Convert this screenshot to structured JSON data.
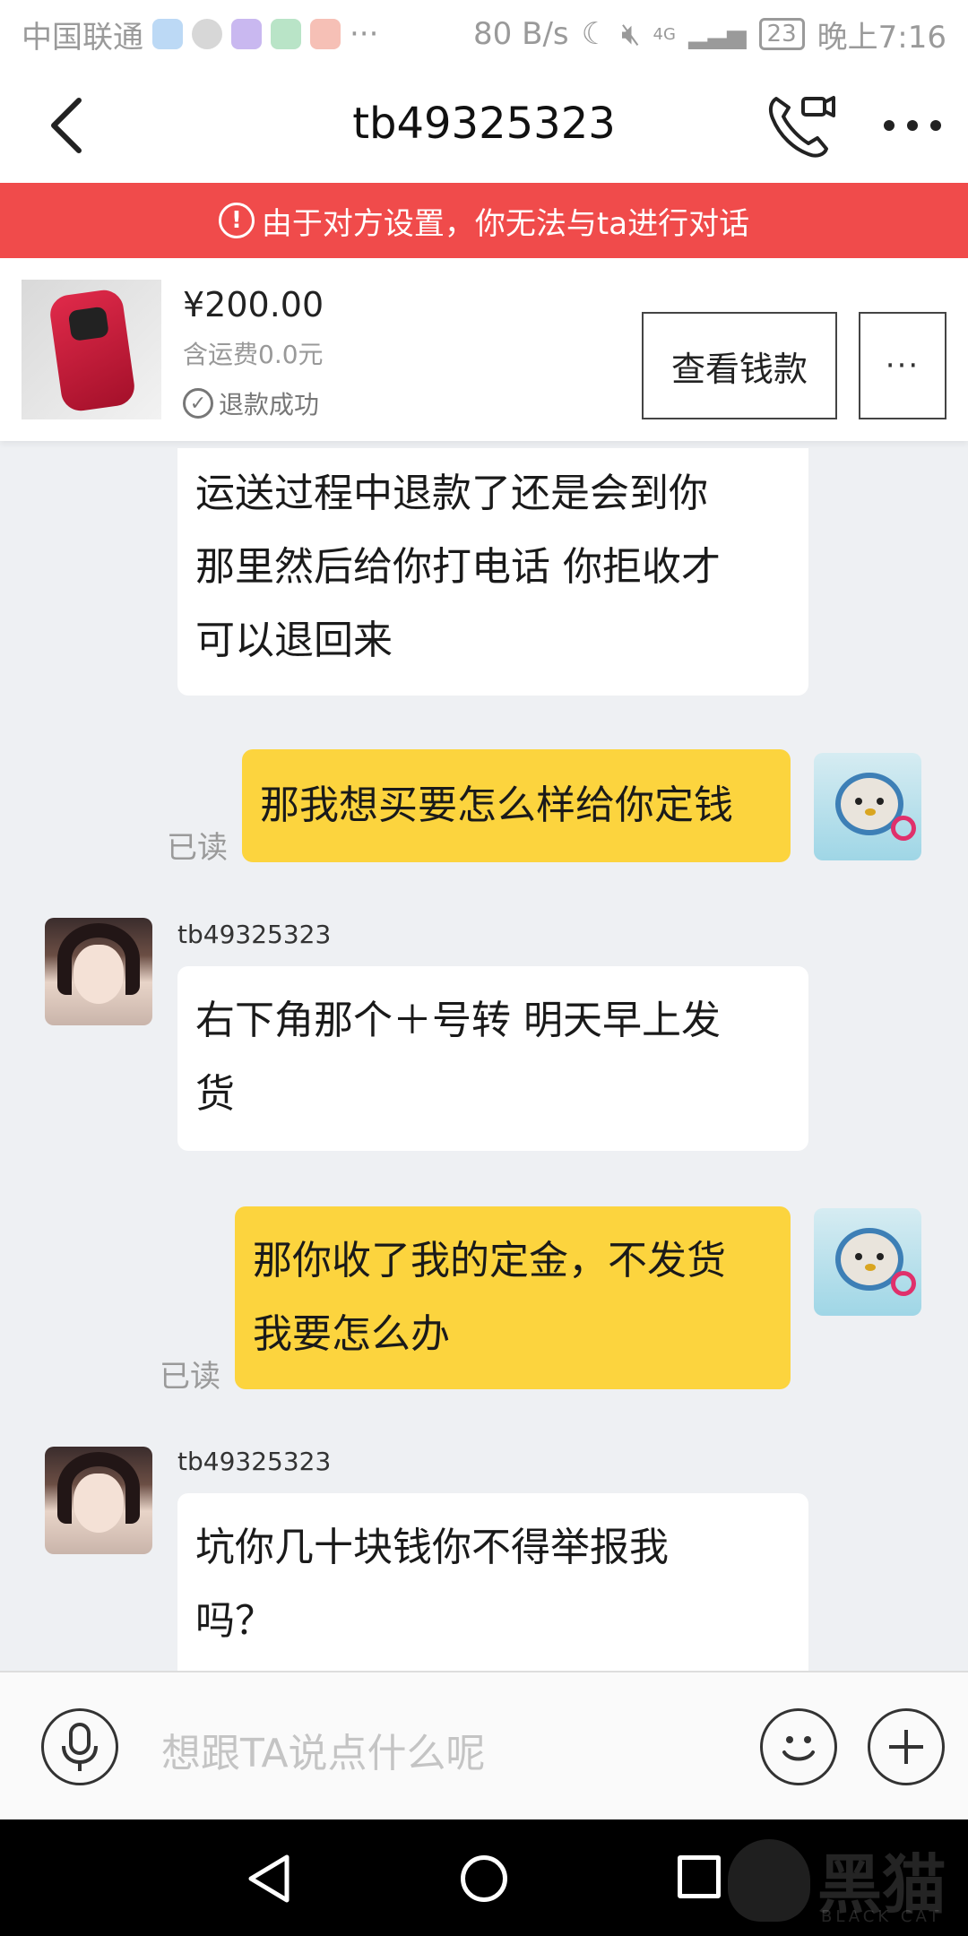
{
  "status_bar": {
    "carrier": "中国联通",
    "extra": "···",
    "speed": "80 B/s",
    "network": "4G",
    "battery": "23",
    "time": "晚上7:16"
  },
  "header": {
    "title": "tb49325323"
  },
  "banner": {
    "text": "由于对方设置，你无法与ta进行对话"
  },
  "product": {
    "price": "¥200.00",
    "shipping": "含运费0.0元",
    "status": "退款成功",
    "view_button": "查看钱款",
    "more_button": "···"
  },
  "messages": [
    {
      "side": "in",
      "text_lines": [
        "运送过程中退款了还是会到你",
        "那里然后给你打电话 你拒收才",
        "可以退回来"
      ]
    },
    {
      "side": "out",
      "read": "已读",
      "text_lines": [
        "那我想买要怎么样给你定钱"
      ]
    },
    {
      "side": "in",
      "sender": "tb49325323",
      "text_lines": [
        "右下角那个＋号转 明天早上发",
        "货"
      ]
    },
    {
      "side": "out",
      "read": "已读",
      "text_lines": [
        "那你收了我的定金，不发货",
        "我要怎么办"
      ]
    },
    {
      "side": "in",
      "sender": "tb49325323",
      "text_lines": [
        "坑你几十块钱你不得举报我",
        "吗？"
      ]
    }
  ],
  "input": {
    "placeholder": "想跟TA说点什么呢"
  },
  "watermark": {
    "text": "黑猫",
    "sub": "BLACK CAT"
  },
  "colors": {
    "banner_red": "#f04b4b",
    "outgoing_bubble": "#fcd43e",
    "incoming_bubble": "#ffffff",
    "chat_bg": "#eef0f3"
  }
}
